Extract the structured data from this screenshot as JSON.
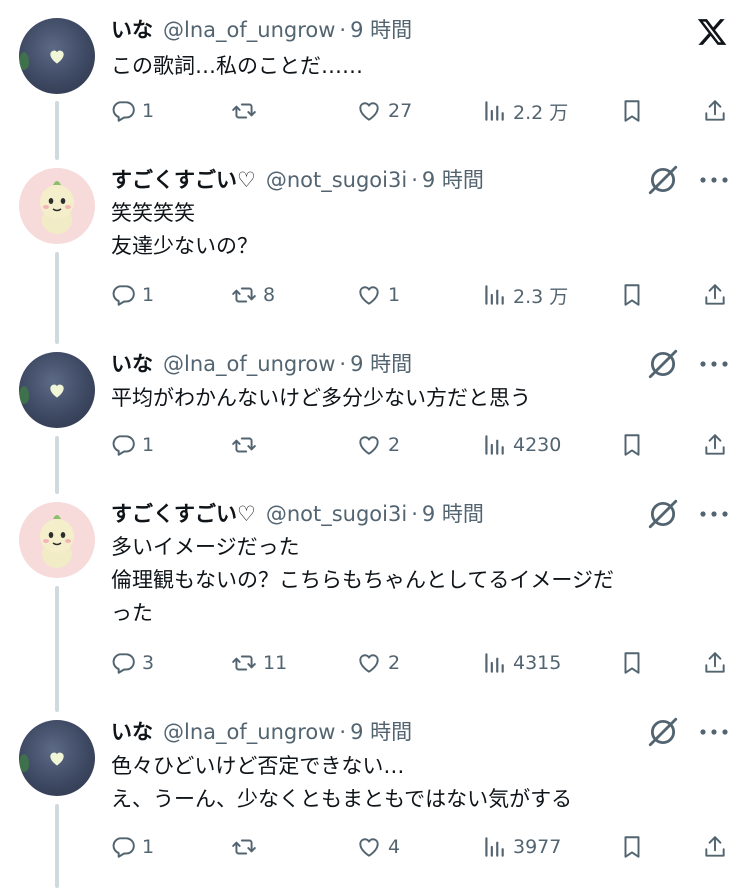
{
  "brand": {
    "logo": "x-logo-icon"
  },
  "colors": {
    "text_primary": "#0f1419",
    "text_secondary": "#536471",
    "thread_line": "#cfd9de"
  },
  "posts": [
    {
      "display_name": "いな",
      "handle": "@lna_of_ungrow",
      "separator": "·",
      "time": "9 時間",
      "lines": [
        "この歌詞…私のことだ……"
      ],
      "stats": {
        "replies": "1",
        "reposts": "",
        "likes": "27",
        "views": "2.2 万"
      }
    },
    {
      "display_name": "すごくすごい♡",
      "handle": "@not_sugoi3i",
      "separator": "·",
      "time": "9 時間",
      "lines": [
        "笑笑笑笑",
        "友達少ないの？"
      ],
      "stats": {
        "replies": "1",
        "reposts": "8",
        "likes": "1",
        "views": "2.3 万"
      }
    },
    {
      "display_name": "いな",
      "handle": "@lna_of_ungrow",
      "separator": "·",
      "time": "9 時間",
      "lines": [
        "平均がわかんないけど多分少ない方だと思う"
      ],
      "stats": {
        "replies": "1",
        "reposts": "",
        "likes": "2",
        "views": "4230"
      }
    },
    {
      "display_name": "すごくすごい♡",
      "handle": "@not_sugoi3i",
      "separator": "·",
      "time": "9 時間",
      "lines": [
        "多いイメージだった",
        "倫理観もないの？こちらもちゃんとしてるイメージだ",
        "った"
      ],
      "stats": {
        "replies": "3",
        "reposts": "11",
        "likes": "2",
        "views": "4315"
      }
    },
    {
      "display_name": "いな",
      "handle": "@lna_of_ungrow",
      "separator": "·",
      "time": "9 時間",
      "lines": [
        "色々ひどいけど否定できない…",
        "え、うーん、少なくともまともではない気がする"
      ],
      "stats": {
        "replies": "1",
        "reposts": "",
        "likes": "4",
        "views": "3977"
      }
    }
  ]
}
